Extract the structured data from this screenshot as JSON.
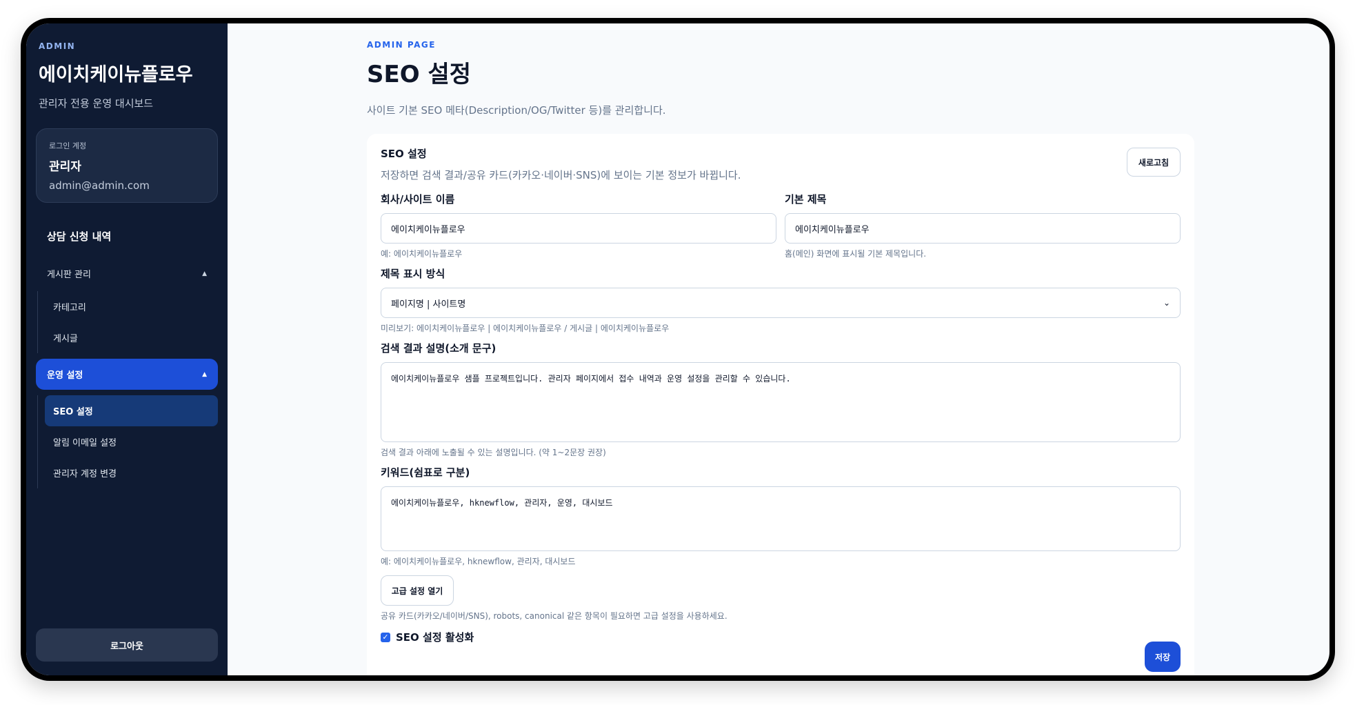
{
  "sidebar": {
    "brand_tag": "ADMIN",
    "brand_title": "에이치케이뉴플로우",
    "brand_subtitle": "관리자 전용 운영 대시보드",
    "account": {
      "label": "로그인 계정",
      "name": "관리자",
      "email": "admin@admin.com"
    },
    "nav": {
      "consultations": "상담 신청 내역",
      "board_group": "게시판 관리",
      "board_items": [
        "카테고리",
        "게시글"
      ],
      "ops_group": "운영 설정",
      "ops_items": [
        "SEO 설정",
        "알림 이메일 설정",
        "관리자 계정 변경"
      ],
      "active_item": "SEO 설정"
    },
    "logout": "로그아웃"
  },
  "header": {
    "eyebrow": "ADMIN PAGE",
    "title": "SEO 설정",
    "description": "사이트 기본 SEO 메타(Description/OG/Twitter 등)를 관리합니다."
  },
  "card": {
    "title": "SEO 설정",
    "description": "저장하면 검색 결과/공유 카드(카카오·네이버·SNS)에 보이는 기본 정보가 바뀝니다.",
    "refresh_label": "새로고침",
    "site_name": {
      "label": "회사/사이트 이름",
      "value": "에이치케이뉴플로우",
      "hint": "예: 에이치케이뉴플로우"
    },
    "default_title": {
      "label": "기본 제목",
      "value": "에이치케이뉴플로우",
      "hint": "홈(메인) 화면에 표시될 기본 제목입니다."
    },
    "title_format": {
      "label": "제목 표시 방식",
      "selected": "페이지명 | 사이트명",
      "preview": "미리보기: 에이치케이뉴플로우 | 에이치케이뉴플로우 / 게시글 | 에이치케이뉴플로우"
    },
    "meta_description": {
      "label": "검색 결과 설명(소개 문구)",
      "value": "에이치케이뉴플로우 샘플 프로젝트입니다. 관리자 페이지에서 접수 내역과 운영 설정을 관리할 수 있습니다.",
      "hint": "검색 결과 아래에 노출될 수 있는 설명입니다. (약 1~2문장 권장)"
    },
    "keywords": {
      "label": "키워드(쉼표로 구분)",
      "value": "에이치케이뉴플로우, hknewflow, 관리자, 운영, 대시보드",
      "hint": "예: 에이치케이뉴플로우, hknewflow, 관리자, 대시보드"
    },
    "advanced_button": "고급 설정 열기",
    "advanced_hint": "공유 카드(카카오/네이버/SNS), robots, canonical 같은 항목이 필요하면 고급 설정을 사용하세요.",
    "enable_label": "SEO 설정 활성화",
    "enabled": true,
    "save_label": "저장"
  },
  "colors": {
    "sidebar_bg": "#0f1b33",
    "accent": "#1d4fd8",
    "text": "#0f172a",
    "muted": "#64748b"
  }
}
